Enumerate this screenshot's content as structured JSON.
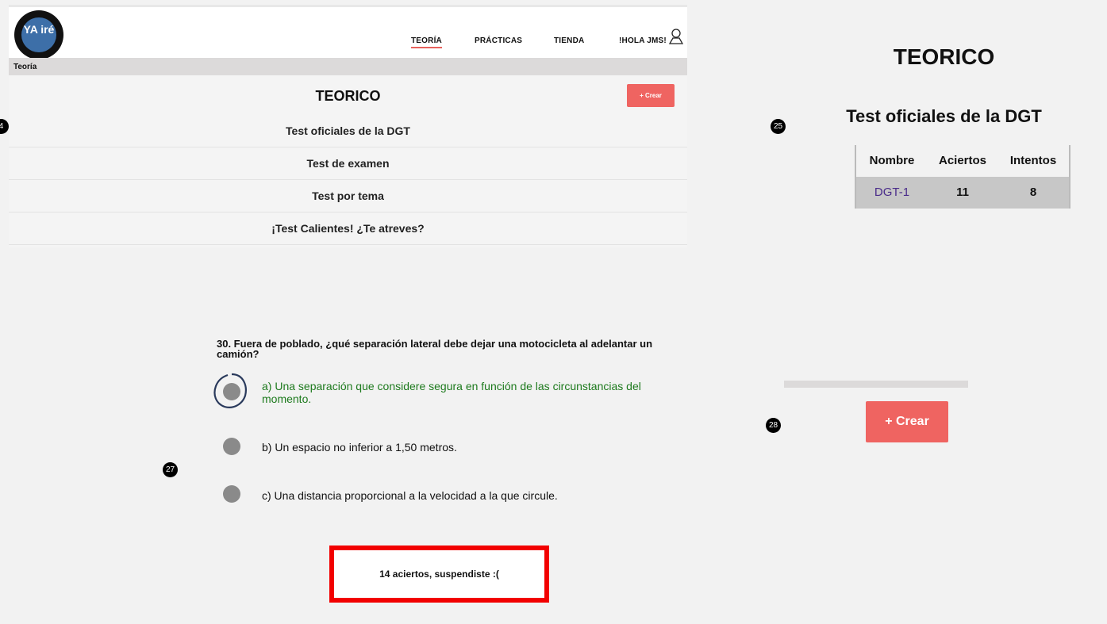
{
  "panel1": {
    "logo_text": "YA iré",
    "nav": [
      "TEORÍA",
      "PRÁCTICAS",
      "TIENDA",
      "!HOLA JMS!"
    ],
    "breadcrumb": "Teoría",
    "title": "TEORICO",
    "crear_label": "+ Crear",
    "items": [
      "Test oficiales de la DGT",
      "Test de examen",
      "Test por tema",
      "¡Test Calientes! ¿Te atreves?"
    ],
    "marker": "4",
    "accent": "#ef6461"
  },
  "panel2": {
    "marker": "25",
    "title": "TEORICO",
    "subtitle": "Test oficiales de la DGT",
    "table": {
      "headers": [
        "Nombre",
        "Aciertos",
        "Intentos"
      ],
      "rows": [
        [
          "DGT-1",
          "11",
          "8"
        ]
      ]
    }
  },
  "panel3": {
    "marker": "27",
    "question": "30. Fuera de poblado, ¿qué separación lateral debe dejar una motocicleta al adelantar un camión?",
    "options": [
      "a) Una separación que considere segura en función de las circunstancias del momento.",
      "b) Un espacio no inferior a 1,50 metros.",
      "c) Una distancia proporcional a la velocidad a la que circule."
    ],
    "result": "14 aciertos, suspendiste :(",
    "correct_color": "#1d7a1d",
    "highlight_color": "#f20000"
  },
  "panel4": {
    "marker": "28",
    "crear_label": "+ Crear"
  }
}
